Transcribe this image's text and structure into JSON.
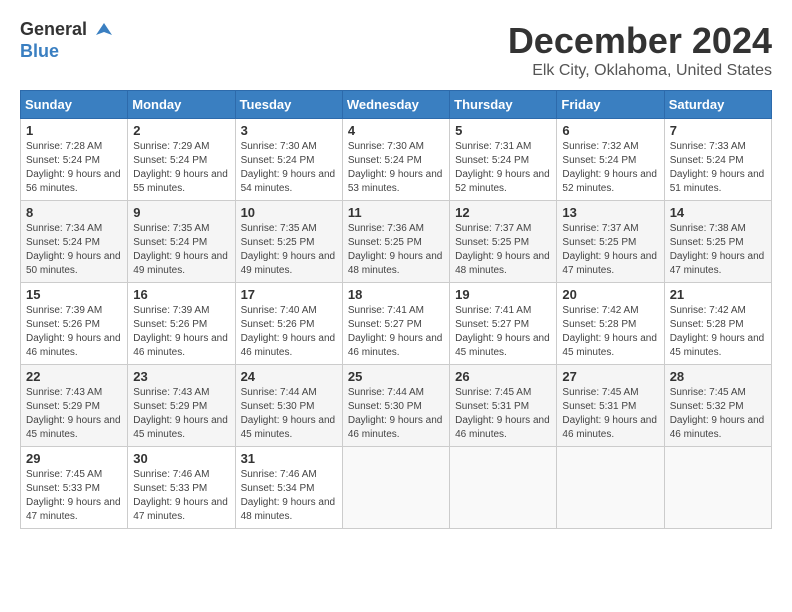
{
  "header": {
    "logo_general": "General",
    "logo_blue": "Blue",
    "month": "December 2024",
    "location": "Elk City, Oklahoma, United States"
  },
  "weekdays": [
    "Sunday",
    "Monday",
    "Tuesday",
    "Wednesday",
    "Thursday",
    "Friday",
    "Saturday"
  ],
  "weeks": [
    [
      {
        "day": "1",
        "sunrise": "Sunrise: 7:28 AM",
        "sunset": "Sunset: 5:24 PM",
        "daylight": "Daylight: 9 hours and 56 minutes."
      },
      {
        "day": "2",
        "sunrise": "Sunrise: 7:29 AM",
        "sunset": "Sunset: 5:24 PM",
        "daylight": "Daylight: 9 hours and 55 minutes."
      },
      {
        "day": "3",
        "sunrise": "Sunrise: 7:30 AM",
        "sunset": "Sunset: 5:24 PM",
        "daylight": "Daylight: 9 hours and 54 minutes."
      },
      {
        "day": "4",
        "sunrise": "Sunrise: 7:30 AM",
        "sunset": "Sunset: 5:24 PM",
        "daylight": "Daylight: 9 hours and 53 minutes."
      },
      {
        "day": "5",
        "sunrise": "Sunrise: 7:31 AM",
        "sunset": "Sunset: 5:24 PM",
        "daylight": "Daylight: 9 hours and 52 minutes."
      },
      {
        "day": "6",
        "sunrise": "Sunrise: 7:32 AM",
        "sunset": "Sunset: 5:24 PM",
        "daylight": "Daylight: 9 hours and 52 minutes."
      },
      {
        "day": "7",
        "sunrise": "Sunrise: 7:33 AM",
        "sunset": "Sunset: 5:24 PM",
        "daylight": "Daylight: 9 hours and 51 minutes."
      }
    ],
    [
      {
        "day": "8",
        "sunrise": "Sunrise: 7:34 AM",
        "sunset": "Sunset: 5:24 PM",
        "daylight": "Daylight: 9 hours and 50 minutes."
      },
      {
        "day": "9",
        "sunrise": "Sunrise: 7:35 AM",
        "sunset": "Sunset: 5:24 PM",
        "daylight": "Daylight: 9 hours and 49 minutes."
      },
      {
        "day": "10",
        "sunrise": "Sunrise: 7:35 AM",
        "sunset": "Sunset: 5:25 PM",
        "daylight": "Daylight: 9 hours and 49 minutes."
      },
      {
        "day": "11",
        "sunrise": "Sunrise: 7:36 AM",
        "sunset": "Sunset: 5:25 PM",
        "daylight": "Daylight: 9 hours and 48 minutes."
      },
      {
        "day": "12",
        "sunrise": "Sunrise: 7:37 AM",
        "sunset": "Sunset: 5:25 PM",
        "daylight": "Daylight: 9 hours and 48 minutes."
      },
      {
        "day": "13",
        "sunrise": "Sunrise: 7:37 AM",
        "sunset": "Sunset: 5:25 PM",
        "daylight": "Daylight: 9 hours and 47 minutes."
      },
      {
        "day": "14",
        "sunrise": "Sunrise: 7:38 AM",
        "sunset": "Sunset: 5:25 PM",
        "daylight": "Daylight: 9 hours and 47 minutes."
      }
    ],
    [
      {
        "day": "15",
        "sunrise": "Sunrise: 7:39 AM",
        "sunset": "Sunset: 5:26 PM",
        "daylight": "Daylight: 9 hours and 46 minutes."
      },
      {
        "day": "16",
        "sunrise": "Sunrise: 7:39 AM",
        "sunset": "Sunset: 5:26 PM",
        "daylight": "Daylight: 9 hours and 46 minutes."
      },
      {
        "day": "17",
        "sunrise": "Sunrise: 7:40 AM",
        "sunset": "Sunset: 5:26 PM",
        "daylight": "Daylight: 9 hours and 46 minutes."
      },
      {
        "day": "18",
        "sunrise": "Sunrise: 7:41 AM",
        "sunset": "Sunset: 5:27 PM",
        "daylight": "Daylight: 9 hours and 46 minutes."
      },
      {
        "day": "19",
        "sunrise": "Sunrise: 7:41 AM",
        "sunset": "Sunset: 5:27 PM",
        "daylight": "Daylight: 9 hours and 45 minutes."
      },
      {
        "day": "20",
        "sunrise": "Sunrise: 7:42 AM",
        "sunset": "Sunset: 5:28 PM",
        "daylight": "Daylight: 9 hours and 45 minutes."
      },
      {
        "day": "21",
        "sunrise": "Sunrise: 7:42 AM",
        "sunset": "Sunset: 5:28 PM",
        "daylight": "Daylight: 9 hours and 45 minutes."
      }
    ],
    [
      {
        "day": "22",
        "sunrise": "Sunrise: 7:43 AM",
        "sunset": "Sunset: 5:29 PM",
        "daylight": "Daylight: 9 hours and 45 minutes."
      },
      {
        "day": "23",
        "sunrise": "Sunrise: 7:43 AM",
        "sunset": "Sunset: 5:29 PM",
        "daylight": "Daylight: 9 hours and 45 minutes."
      },
      {
        "day": "24",
        "sunrise": "Sunrise: 7:44 AM",
        "sunset": "Sunset: 5:30 PM",
        "daylight": "Daylight: 9 hours and 45 minutes."
      },
      {
        "day": "25",
        "sunrise": "Sunrise: 7:44 AM",
        "sunset": "Sunset: 5:30 PM",
        "daylight": "Daylight: 9 hours and 46 minutes."
      },
      {
        "day": "26",
        "sunrise": "Sunrise: 7:45 AM",
        "sunset": "Sunset: 5:31 PM",
        "daylight": "Daylight: 9 hours and 46 minutes."
      },
      {
        "day": "27",
        "sunrise": "Sunrise: 7:45 AM",
        "sunset": "Sunset: 5:31 PM",
        "daylight": "Daylight: 9 hours and 46 minutes."
      },
      {
        "day": "28",
        "sunrise": "Sunrise: 7:45 AM",
        "sunset": "Sunset: 5:32 PM",
        "daylight": "Daylight: 9 hours and 46 minutes."
      }
    ],
    [
      {
        "day": "29",
        "sunrise": "Sunrise: 7:45 AM",
        "sunset": "Sunset: 5:33 PM",
        "daylight": "Daylight: 9 hours and 47 minutes."
      },
      {
        "day": "30",
        "sunrise": "Sunrise: 7:46 AM",
        "sunset": "Sunset: 5:33 PM",
        "daylight": "Daylight: 9 hours and 47 minutes."
      },
      {
        "day": "31",
        "sunrise": "Sunrise: 7:46 AM",
        "sunset": "Sunset: 5:34 PM",
        "daylight": "Daylight: 9 hours and 48 minutes."
      },
      null,
      null,
      null,
      null
    ]
  ]
}
